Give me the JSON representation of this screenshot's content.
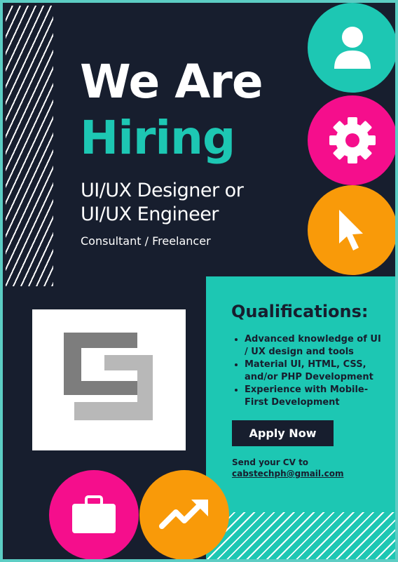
{
  "headline": {
    "line1": "We Are",
    "line2": "Hiring"
  },
  "roles": {
    "line1": "UI/UX Designer or",
    "line2": "UI/UX Engineer"
  },
  "engagement": "Consultant / Freelancer",
  "qualifications": {
    "title": "Qualifications:",
    "items": [
      "Advanced knowledge of UI / UX design and tools",
      "Material UI, HTML, CSS, and/or PHP Development",
      "Experience with Mobile-First Development"
    ]
  },
  "cta": {
    "label": "Apply Now"
  },
  "contact": {
    "text": "Send your CV to",
    "email": "cabstechph@gmail.com"
  },
  "icons": [
    "user-icon",
    "gear-icon",
    "cursor-pointer-icon",
    "briefcase-icon",
    "trending-up-icon",
    "company-logo"
  ],
  "colors": {
    "background": "#171e2e",
    "teal": "#1dc7b3",
    "pink": "#f50e8c",
    "orange": "#f99a09",
    "white": "#ffffff"
  }
}
